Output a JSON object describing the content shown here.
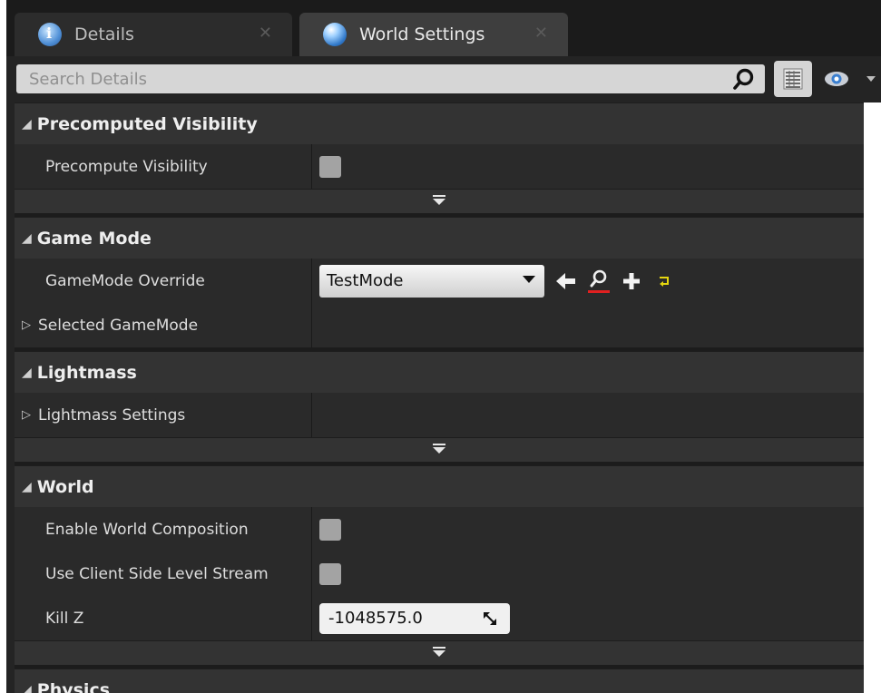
{
  "tabs": [
    {
      "label": "Details",
      "icon": "info-icon",
      "active": false
    },
    {
      "label": "World Settings",
      "icon": "world-globe-icon",
      "active": true
    }
  ],
  "search": {
    "placeholder": "Search Details",
    "value": ""
  },
  "categories": {
    "precomputed_visibility": {
      "title": "Precomputed Visibility",
      "rows": [
        {
          "label": "Precompute Visibility",
          "checked": false
        }
      ]
    },
    "game_mode": {
      "title": "Game Mode",
      "rows": [
        {
          "label": "GameMode Override",
          "value": "TestMode"
        },
        {
          "label": "Selected GameMode"
        }
      ]
    },
    "lightmass": {
      "title": "Lightmass",
      "rows": [
        {
          "label": "Lightmass Settings"
        }
      ]
    },
    "world": {
      "title": "World",
      "rows": [
        {
          "label": "Enable World Composition",
          "checked": false
        },
        {
          "label": "Use Client Side Level Stream",
          "checked": false
        },
        {
          "label": "Kill Z",
          "value": "-1048575.0"
        }
      ]
    },
    "physics": {
      "title": "Physics"
    }
  },
  "colors": {
    "panel_bg": "#242424",
    "category_bg": "#333333",
    "row_bg": "#2a2a2a",
    "browse_underline": "#e02020",
    "reset_arrow": "#e5d60f"
  }
}
